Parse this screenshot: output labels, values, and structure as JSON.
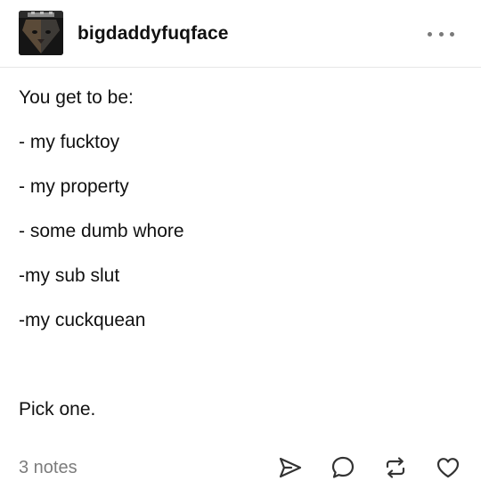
{
  "post": {
    "author": {
      "username": "bigdaddyfuqface",
      "avatar_icon": "lion-avatar"
    },
    "menu_icon": "more-options-icon",
    "body_lines": [
      "You get to be:",
      "- my fucktoy",
      "- my property",
      "- some dumb whore",
      "-my sub slut",
      "-my cuckquean",
      "",
      "Pick one."
    ],
    "footer": {
      "notes": "3 notes",
      "actions": [
        "share-icon",
        "reply-icon",
        "reblog-icon",
        "like-icon"
      ]
    }
  },
  "colors": {
    "text": "#111111",
    "muted": "#7c7c7c",
    "divider": "#e6e6e6",
    "background": "#ffffff"
  }
}
